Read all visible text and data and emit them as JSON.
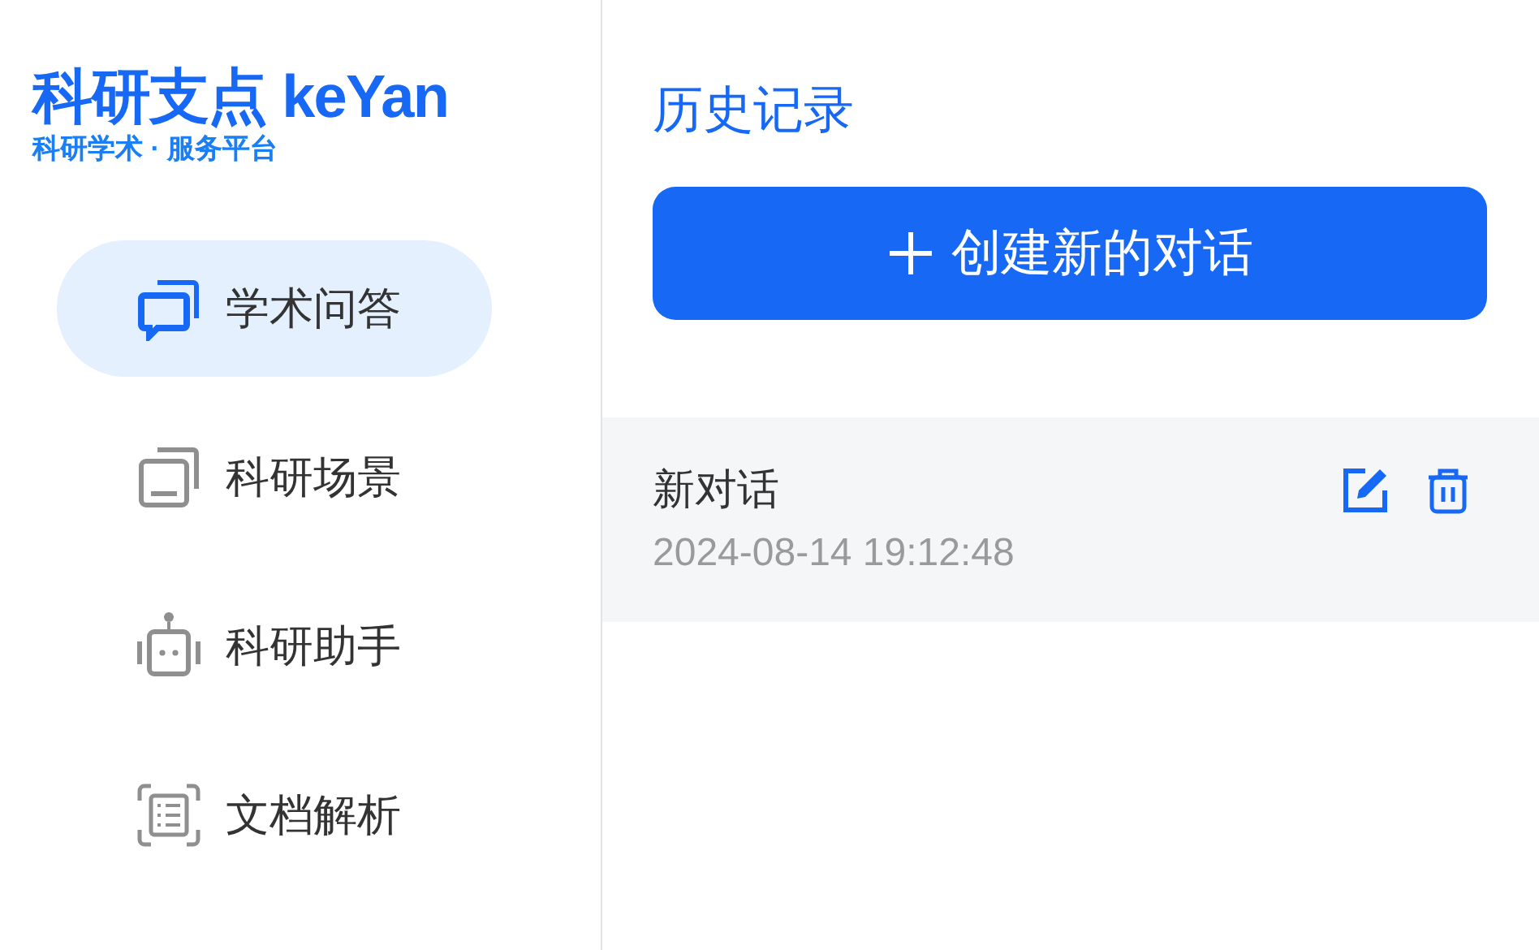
{
  "logo": {
    "title": "科研支点 keYan",
    "subtitle": "科研学术 · 服务平台"
  },
  "nav": [
    {
      "kind": "chat",
      "label": "学术问答",
      "selected": true
    },
    {
      "kind": "scene",
      "label": "科研场景",
      "selected": false
    },
    {
      "kind": "robot",
      "label": "科研助手",
      "selected": false
    },
    {
      "kind": "doc",
      "label": "文档解析",
      "selected": false
    }
  ],
  "history": {
    "title": "历史记录",
    "new_button": "创建新的对话",
    "items": [
      {
        "title": "新对话",
        "time": "2024-08-14 19:12:48"
      }
    ]
  }
}
